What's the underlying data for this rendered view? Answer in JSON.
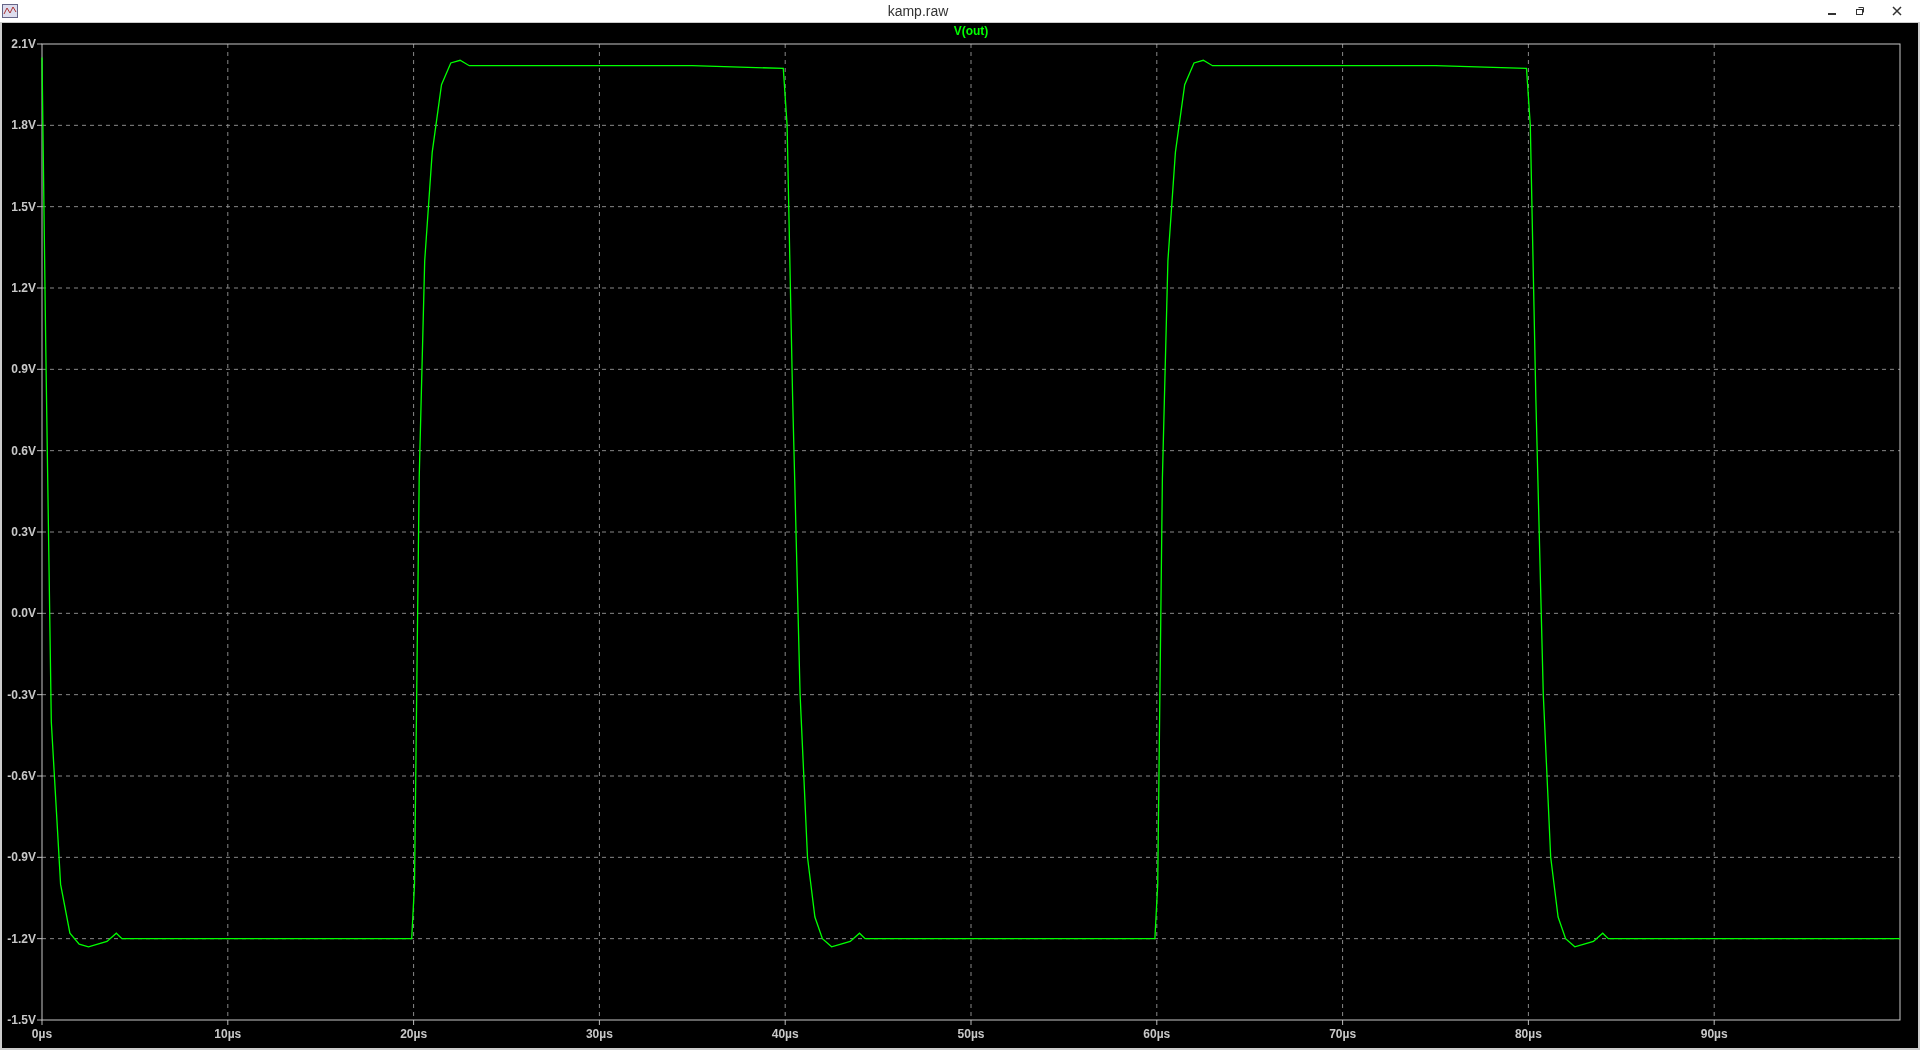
{
  "window": {
    "title": "kamp.raw"
  },
  "plot": {
    "chart_data": {
      "type": "line",
      "grid": true,
      "xlim": [
        0,
        100
      ],
      "ylim": [
        -1.5,
        2.1
      ],
      "xticks": [
        {
          "value": 0,
          "label": "0µs"
        },
        {
          "value": 10,
          "label": "10µs"
        },
        {
          "value": 20,
          "label": "20µs"
        },
        {
          "value": 30,
          "label": "30µs"
        },
        {
          "value": 40,
          "label": "40µs"
        },
        {
          "value": 50,
          "label": "50µs"
        },
        {
          "value": 60,
          "label": "60µs"
        },
        {
          "value": 70,
          "label": "70µs"
        },
        {
          "value": 80,
          "label": "80µs"
        },
        {
          "value": 90,
          "label": "90µs"
        }
      ],
      "yticks": [
        {
          "value": 2.1,
          "label": "2.1V"
        },
        {
          "value": 1.8,
          "label": "1.8V"
        },
        {
          "value": 1.5,
          "label": "1.5V"
        },
        {
          "value": 1.2,
          "label": "1.2V"
        },
        {
          "value": 0.9,
          "label": "0.9V"
        },
        {
          "value": 0.6,
          "label": "0.6V"
        },
        {
          "value": 0.3,
          "label": "0.3V"
        },
        {
          "value": 0,
          "label": "0.0V"
        },
        {
          "value": -0.3,
          "label": "-0.3V"
        },
        {
          "value": -0.6,
          "label": "-0.6V"
        },
        {
          "value": -0.9,
          "label": "-0.9V"
        },
        {
          "value": -1.2,
          "label": "-1.2V"
        },
        {
          "value": -1.5,
          "label": "-1.5V"
        }
      ],
      "x": [
        0,
        0.2,
        0.5,
        1,
        1.5,
        2,
        2.5,
        3,
        3.5,
        4,
        4.3,
        5,
        10,
        15,
        19.9,
        20.05,
        20.3,
        20.6,
        21,
        21.5,
        22,
        22.5,
        23,
        25,
        30,
        35,
        39.9,
        40.1,
        40.4,
        40.8,
        41.2,
        41.6,
        42,
        42.5,
        43,
        43.5,
        44,
        44.3,
        45,
        50,
        55,
        59.9,
        60.05,
        60.3,
        60.6,
        61,
        61.5,
        62,
        62.5,
        63,
        65,
        70,
        75,
        79.9,
        80.1,
        80.4,
        80.8,
        81.2,
        81.6,
        82,
        82.5,
        83,
        83.5,
        84,
        84.3,
        85,
        90,
        95,
        100
      ],
      "series": [
        {
          "name": "V(out)",
          "color": "#00ff00",
          "values": [
            2.05,
            1.0,
            -0.4,
            -1.0,
            -1.18,
            -1.22,
            -1.23,
            -1.22,
            -1.21,
            -1.18,
            -1.2,
            -1.2,
            -1.2,
            -1.2,
            -1.2,
            -1.0,
            0.5,
            1.3,
            1.7,
            1.95,
            2.03,
            2.04,
            2.02,
            2.02,
            2.02,
            2.02,
            2.01,
            1.8,
            0.8,
            -0.3,
            -0.9,
            -1.12,
            -1.2,
            -1.23,
            -1.22,
            -1.21,
            -1.18,
            -1.2,
            -1.2,
            -1.2,
            -1.2,
            -1.2,
            -1.0,
            0.5,
            1.3,
            1.7,
            1.95,
            2.03,
            2.04,
            2.02,
            2.02,
            2.02,
            2.02,
            2.01,
            1.8,
            0.8,
            -0.3,
            -0.9,
            -1.12,
            -1.2,
            -1.23,
            -1.22,
            -1.21,
            -1.18,
            -1.2,
            -1.2,
            -1.2,
            -1.2,
            -1.2
          ]
        }
      ]
    }
  }
}
